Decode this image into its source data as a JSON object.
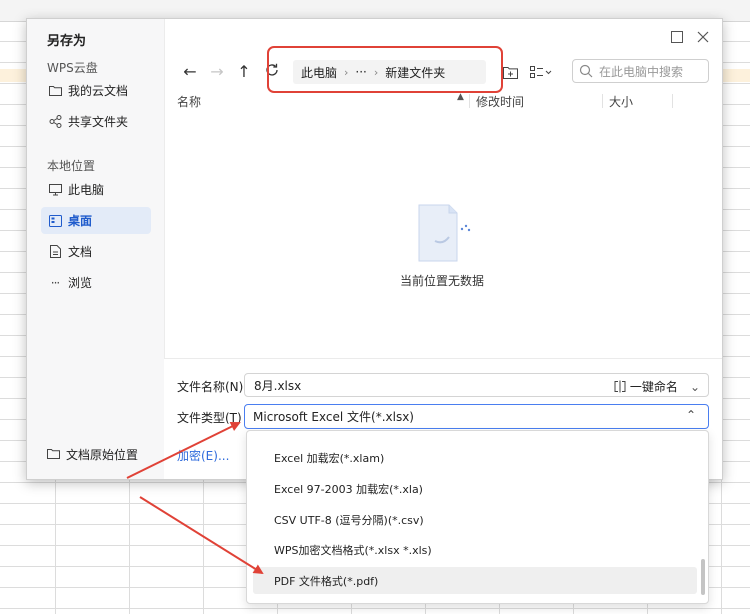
{
  "dialog": {
    "title": "另存为",
    "close_icon": "close-icon",
    "maximize_icon": "maximize-icon"
  },
  "sidebar": {
    "wps_cloud_heading": "WPS云盘",
    "cloud_items": [
      {
        "label": "我的云文档",
        "icon": "folder-icon"
      },
      {
        "label": "共享文件夹",
        "icon": "share-icon"
      }
    ],
    "local_heading": "本地位置",
    "local_items": [
      {
        "label": "此电脑",
        "icon": "monitor-icon"
      },
      {
        "label": "桌面",
        "icon": "desktop-icon",
        "active": true
      },
      {
        "label": "文档",
        "icon": "document-icon"
      },
      {
        "label": "浏览",
        "icon": "more-icon"
      }
    ],
    "original_location": "文档原始位置"
  },
  "breadcrumb": {
    "items": [
      "此电脑",
      "···",
      "新建文件夹"
    ],
    "separator": "›"
  },
  "search": {
    "placeholder": "在此电脑中搜索"
  },
  "columns": {
    "name": "名称",
    "modified": "修改时间",
    "size": "大小"
  },
  "empty_state": "当前位置无数据",
  "form": {
    "file_name_label": "文件名称(N)",
    "file_name_value": "8月.xlsx",
    "rename_label": "一键命名",
    "file_type_label": "文件类型(T)",
    "file_type_value": "Microsoft Excel 文件(*.xlsx)",
    "encrypt_link": "加密(E)..."
  },
  "dropdown": {
    "options": [
      {
        "label": "Excel 加载宏(*.xlam)"
      },
      {
        "label": "Excel 97-2003 加载宏(*.xla)"
      },
      {
        "label": "CSV UTF-8 (逗号分隔)(*.csv)"
      },
      {
        "label": "WPS加密文档格式(*.xlsx *.xls)"
      },
      {
        "label": "PDF 文件格式(*.pdf)",
        "selected": true
      }
    ]
  },
  "colors": {
    "accent": "#2f6bdc",
    "annotation": "#e04237",
    "active_bg": "#e3ebf8"
  }
}
